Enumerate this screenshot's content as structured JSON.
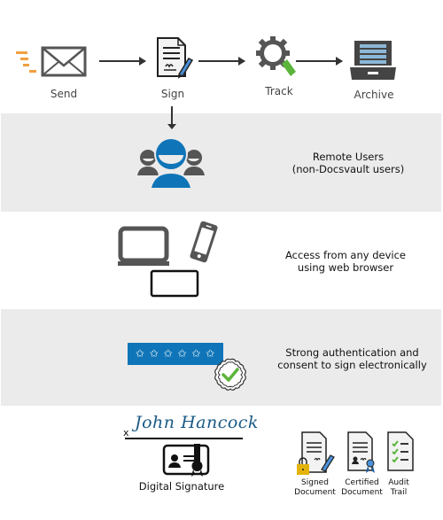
{
  "workflow": {
    "steps": [
      {
        "label": "Send",
        "icon": "envelope-icon"
      },
      {
        "label": "Sign",
        "icon": "sign-document-icon"
      },
      {
        "label": "Track",
        "icon": "gear-magnifier-icon"
      },
      {
        "label": "Archive",
        "icon": "file-drawer-icon"
      }
    ]
  },
  "sections": [
    {
      "text_line1": "Remote Users",
      "text_line2": "(non-Docsvault users)",
      "icon": "users-group-icon"
    },
    {
      "text_line1": "Access from any device",
      "text_line2": "using web browser",
      "icon": "devices-icon"
    },
    {
      "text_line1": "Strong authentication and",
      "text_line2": "consent to sign electronically",
      "icon": "password-field-icon",
      "password_mask": "✩ ✩ ✩ ✩ ✩ ✩"
    }
  ],
  "signature": {
    "x_mark": "x",
    "name": "John Hancock",
    "label": "Digital Signature"
  },
  "outputs": [
    {
      "line1": "Signed",
      "line2": "Document"
    },
    {
      "line1": "Certified",
      "line2": "Document"
    },
    {
      "line1": "Audit",
      "line2": "Trail"
    }
  ],
  "colors": {
    "band": "#ecebeb",
    "brand_blue": "#0f75b8",
    "accent_orange": "#f0a040",
    "accent_green": "#5bb53a",
    "icon_gray": "#555555"
  }
}
